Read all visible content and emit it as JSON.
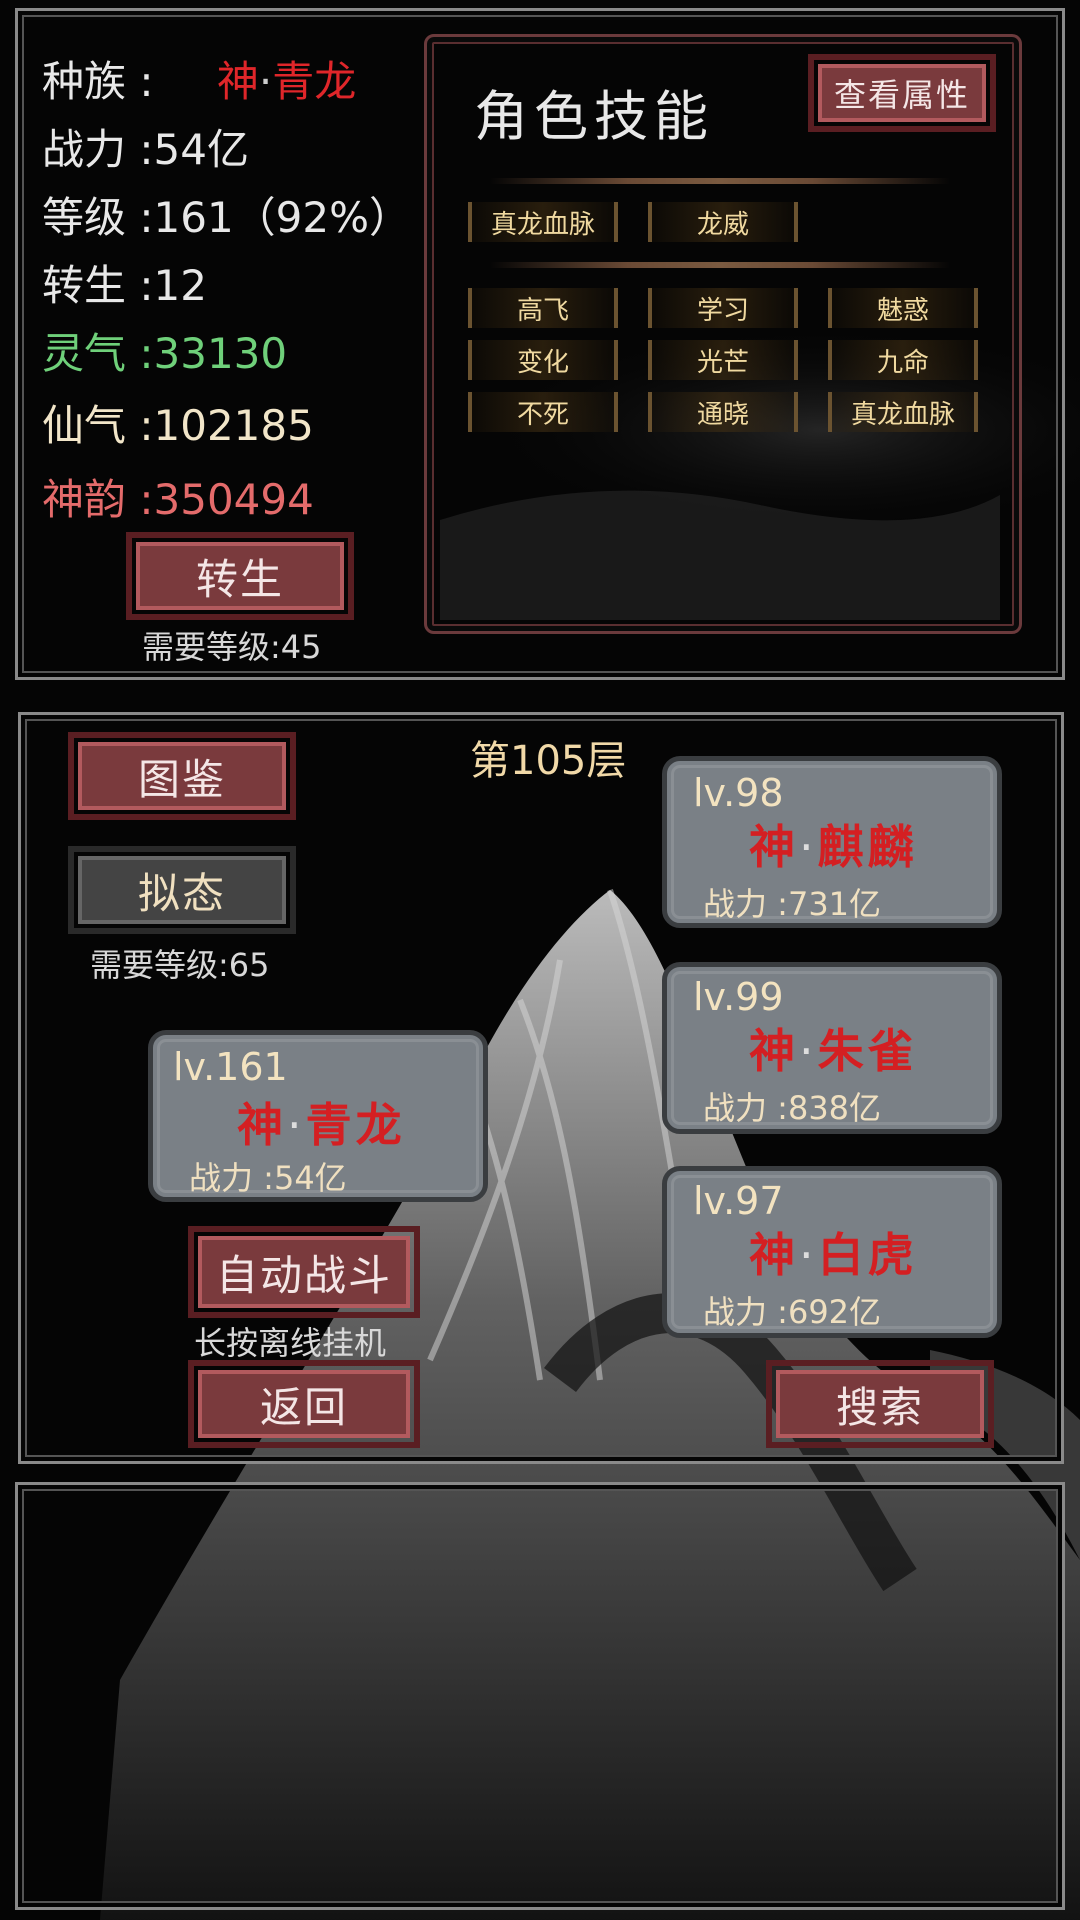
{
  "stats": {
    "race_label": "种族 :",
    "race_value_prefix": "神",
    "race_value_dot": "·",
    "race_value_name": "青龙",
    "power_label": "战力 :",
    "power_value": "54亿",
    "level_label": "等级 :",
    "level_value": "161（92%）",
    "rebirth_label": "转生 :",
    "rebirth_value": "12",
    "lingqi_label": "灵气 :",
    "lingqi_value": "33130",
    "xianqi_label": "仙气 :",
    "xianqi_value": "102185",
    "shenyun_label": "神韵 :",
    "shenyun_value": "350494"
  },
  "rebirth_button": {
    "label": "转生",
    "requirement": "需要等级:45"
  },
  "skills": {
    "title": "角色技能",
    "view_attr_button": "查看属性",
    "primary": [
      "真龙血脉",
      "龙威"
    ],
    "secondary": [
      "高飞",
      "学习",
      "魅惑",
      "变化",
      "光芒",
      "九命",
      "不死",
      "通晓",
      "真龙血脉"
    ]
  },
  "tower": {
    "floor_label": "第105层",
    "catalog_button": "图鉴",
    "mimic_button": "拟态",
    "mimic_requirement": "需要等级:65",
    "auto_battle_button": "自动战斗",
    "auto_battle_hint": "长按离线挂机",
    "back_button": "返回",
    "search_button": "搜索"
  },
  "player_card": {
    "level": "lv.161",
    "prefix": "神",
    "dot": "·",
    "name": "青龙",
    "power": "战力 :54亿"
  },
  "enemies": [
    {
      "level": "lv.98",
      "prefix": "神",
      "dot": "·",
      "name": "麒麟",
      "power": "战力 :731亿"
    },
    {
      "level": "lv.99",
      "prefix": "神",
      "dot": "·",
      "name": "朱雀",
      "power": "战力 :838亿"
    },
    {
      "level": "lv.97",
      "prefix": "神",
      "dot": "·",
      "name": "白虎",
      "power": "战力 :692亿"
    }
  ],
  "colors": {
    "accent_red": "#e0262a",
    "lingqi_green": "#6fd07a",
    "button_red": "#7a3a3d",
    "card_gray": "#7a8086"
  }
}
